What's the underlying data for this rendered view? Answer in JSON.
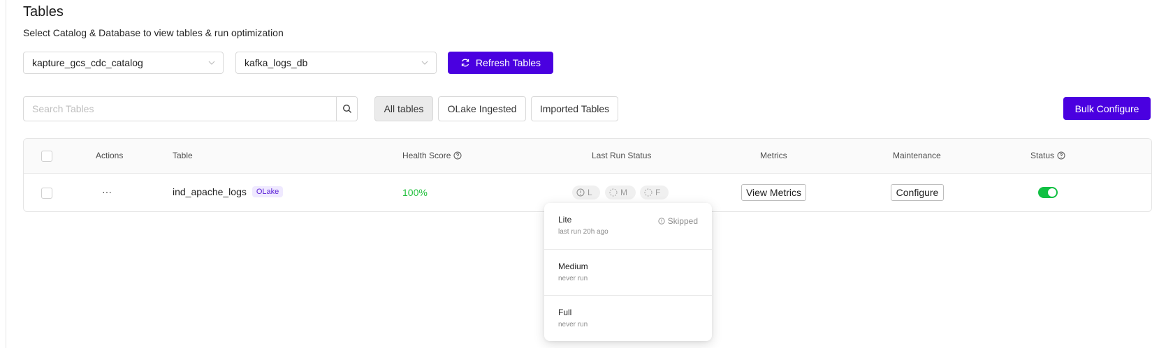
{
  "page": {
    "title": "Tables",
    "subtitle": "Select Catalog & Database to view tables & run optimization"
  },
  "selectors": {
    "catalog": "kapture_gcs_cdc_catalog",
    "database": "kafka_logs_db",
    "refresh_label": "Refresh Tables"
  },
  "search": {
    "placeholder": "Search Tables"
  },
  "filters": {
    "all": "All tables",
    "olake": "OLake Ingested",
    "imported": "Imported Tables"
  },
  "bulk_configure_label": "Bulk Configure",
  "table": {
    "headers": {
      "actions": "Actions",
      "table": "Table",
      "health": "Health Score",
      "last_run": "Last Run Status",
      "metrics": "Metrics",
      "maintenance": "Maintenance",
      "status": "Status"
    },
    "rows": [
      {
        "actions": "···",
        "name": "ind_apache_logs",
        "tag": "OLake",
        "health": "100%",
        "runs": {
          "lite": "L",
          "medium": "M",
          "full": "F"
        },
        "metrics_label": "View Metrics",
        "maintenance_label": "Configure",
        "status_on": true
      }
    ]
  },
  "popover": {
    "items": [
      {
        "name": "Lite",
        "sub": "last run 20h ago",
        "status": "Skipped"
      },
      {
        "name": "Medium",
        "sub": "never run"
      },
      {
        "name": "Full",
        "sub": "never run"
      }
    ]
  },
  "colors": {
    "primary": "#4a00e0",
    "health": "#1fbf3a",
    "toggle_on": "#11c043",
    "tag_bg": "#efe9ff"
  }
}
